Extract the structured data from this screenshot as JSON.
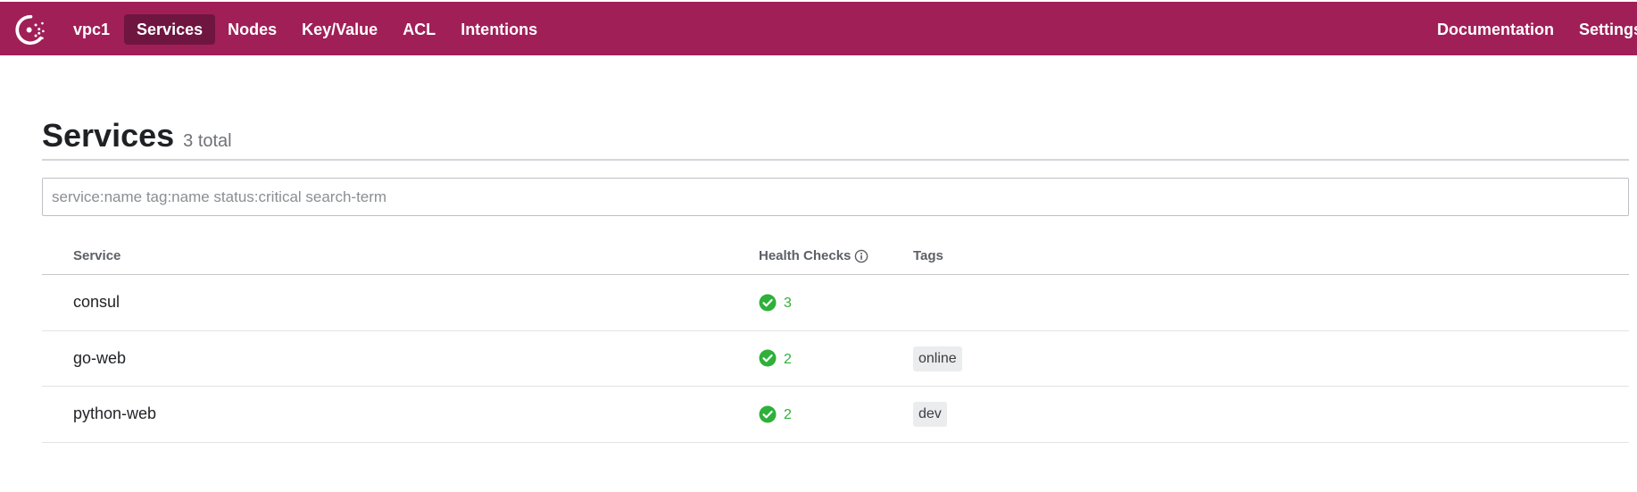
{
  "nav": {
    "datacenter": "vpc1",
    "items": [
      {
        "label": "Services",
        "active": true
      },
      {
        "label": "Nodes",
        "active": false
      },
      {
        "label": "Key/Value",
        "active": false
      },
      {
        "label": "ACL",
        "active": false
      },
      {
        "label": "Intentions",
        "active": false
      }
    ],
    "right": {
      "documentation": "Documentation",
      "settings": "Settings"
    },
    "brand_color": "#a01f57",
    "active_color": "#6e1540"
  },
  "page": {
    "title": "Services",
    "count": "3 total"
  },
  "search": {
    "value": "",
    "placeholder": "service:name tag:name status:critical search-term"
  },
  "table": {
    "headers": {
      "service": "Service",
      "health": "Health Checks",
      "tags": "Tags"
    },
    "rows": [
      {
        "name": "consul",
        "checks": "3",
        "status": "passing",
        "tags": ""
      },
      {
        "name": "go-web",
        "checks": "2",
        "status": "passing",
        "tags": "online"
      },
      {
        "name": "python-web",
        "checks": "2",
        "status": "passing",
        "tags": "dev"
      }
    ],
    "passing_color": "#2eb039"
  }
}
